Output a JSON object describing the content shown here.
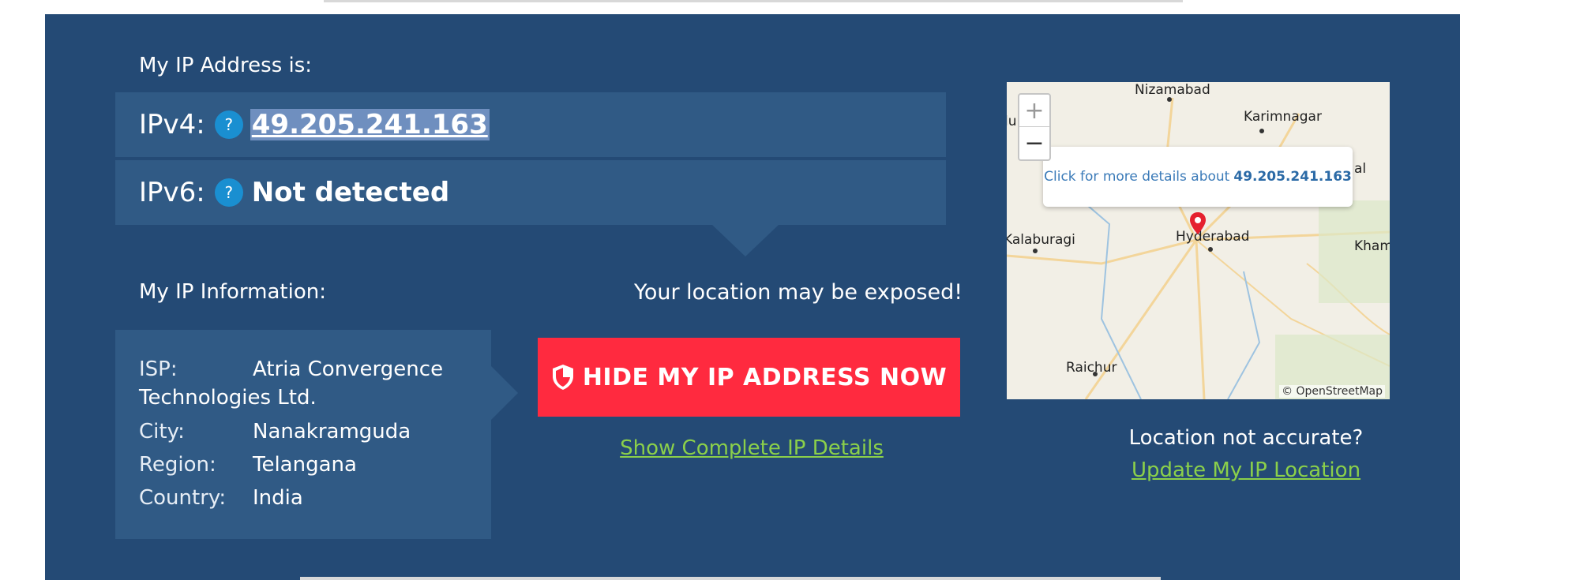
{
  "ip_section": {
    "title": "My IP Address is:",
    "ipv4_label": "IPv4:",
    "ipv4_value": "49.205.241.163",
    "ipv6_label": "IPv6:",
    "ipv6_value": "Not detected",
    "help_glyph": "?"
  },
  "info_section": {
    "title": "My IP Information:",
    "isp_label": "ISP:",
    "isp_value_line1": "Atria Convergence",
    "isp_value_line2": "Technologies Ltd.",
    "city_label": "City:",
    "city_value": "Nanakramguda",
    "region_label": "Region:",
    "region_value": "Telangana",
    "country_label": "Country:",
    "country_value": "India"
  },
  "cta": {
    "warning": "Your location may be exposed!",
    "hide_button": "HIDE MY IP ADDRESS NOW",
    "details_link": "Show Complete IP Details"
  },
  "map": {
    "zoom_in": "+",
    "zoom_out": "−",
    "popup_text": "Click for more details about",
    "popup_ip": "49.205.241.163",
    "cities": {
      "nizamabad": "Nizamabad",
      "karimnagar": "Karimnagar",
      "kalaburagi": "Kalaburagi",
      "hyderabad": "Hyderabad",
      "khammam": "Kham",
      "raichur": "Raichur",
      "cut_left": "lu",
      "cut_right": "al"
    },
    "attribution": "© OpenStreetMap"
  },
  "location": {
    "question": "Location not accurate?",
    "update_link": "Update My IP Location"
  },
  "colors": {
    "panel": "#244a75",
    "row": "#305a85",
    "button": "#ff2a3f",
    "link": "#8bd04a",
    "help": "#1a8fd1"
  }
}
